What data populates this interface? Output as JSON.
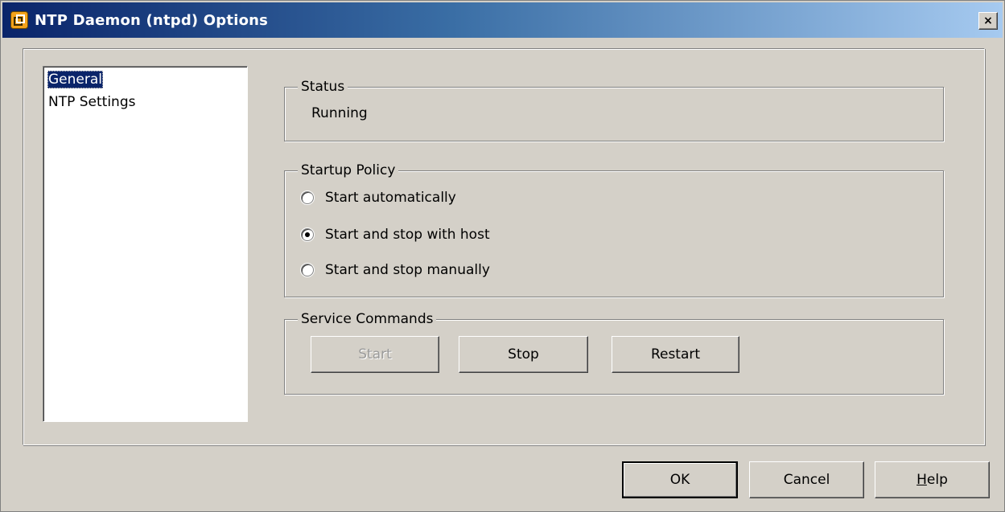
{
  "window": {
    "title": "NTP Daemon (ntpd) Options",
    "icon": "vsphere-app-icon",
    "close_label": "×"
  },
  "sidebar": {
    "items": [
      {
        "label": "General",
        "selected": true
      },
      {
        "label": "NTP Settings",
        "selected": false
      }
    ]
  },
  "status": {
    "legend": "Status",
    "value": "Running"
  },
  "startup_policy": {
    "legend": "Startup Policy",
    "options": [
      {
        "label": "Start automatically",
        "checked": false
      },
      {
        "label": "Start and stop with host",
        "checked": true
      },
      {
        "label": "Start and stop manually",
        "checked": false
      }
    ]
  },
  "service_commands": {
    "legend": "Service Commands",
    "start_label": "Start",
    "stop_label": "Stop",
    "restart_label": "Restart"
  },
  "footer": {
    "ok_label": "OK",
    "cancel_label": "Cancel",
    "help_label_hotkey": "H",
    "help_label_rest": "elp"
  },
  "colors": {
    "titlebar_start": "#0a246a",
    "titlebar_end": "#a6caf0",
    "selection": "#0a246a",
    "dialog_bg": "#d4d0c8"
  }
}
